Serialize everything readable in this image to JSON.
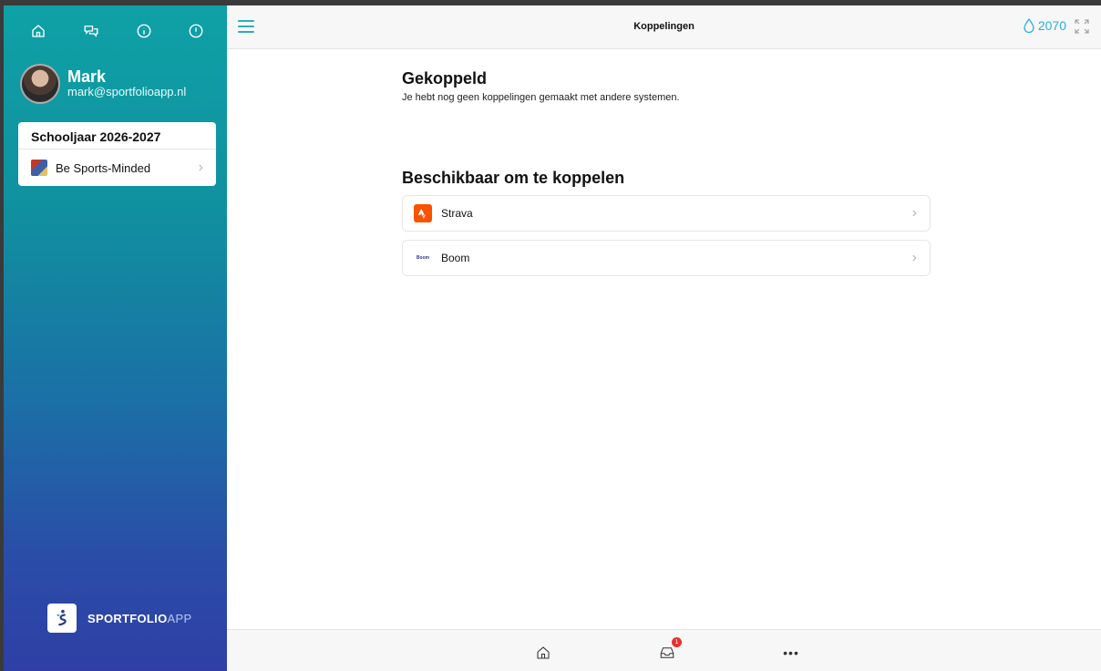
{
  "sidebar": {
    "top_icons": [
      "home-icon",
      "chat-icon",
      "info-icon",
      "alert-icon"
    ],
    "profile": {
      "name": "Mark",
      "email": "mark@sportfolioapp.nl"
    },
    "year_card": {
      "title": "Schooljaar 2026-2027",
      "item_label": "Be Sports-Minded"
    },
    "logo": {
      "bold": "SPORTFOLIO",
      "light": "APP"
    }
  },
  "header": {
    "title": "Koppelingen",
    "points": "2070"
  },
  "main": {
    "linked_title": "Gekoppeld",
    "linked_text": "Je hebt nog geen koppelingen gemaakt met andere systemen.",
    "available_title": "Beschikbaar om te koppelen",
    "connections": [
      {
        "label": "Strava",
        "icon": "strava-icon"
      },
      {
        "label": "Boom",
        "icon": "boom-icon",
        "icon_text": "Boom"
      }
    ]
  },
  "bottombar": {
    "inbox_badge": "1",
    "more": "•••"
  },
  "colors": {
    "accent": "#2ab0b8",
    "points": "#2ab0d8",
    "strava": "#fc5200",
    "badge": "#e5322d"
  }
}
